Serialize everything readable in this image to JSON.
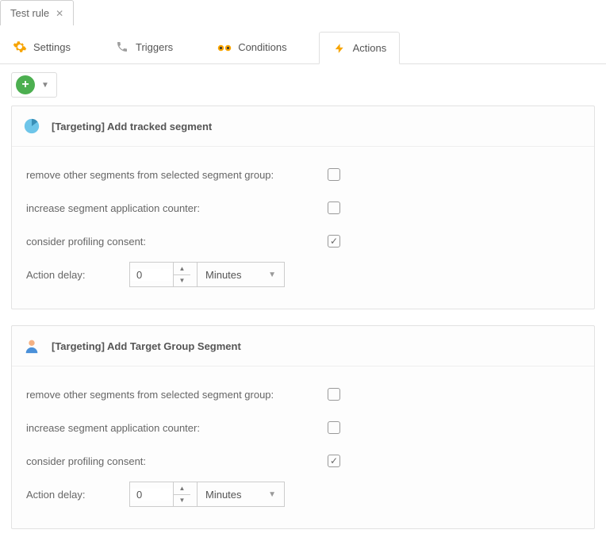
{
  "pageTab": {
    "label": "Test rule"
  },
  "navTabs": [
    {
      "label": "Settings"
    },
    {
      "label": "Triggers"
    },
    {
      "label": "Conditions"
    },
    {
      "label": "Actions"
    }
  ],
  "panels": [
    {
      "title": "[Targeting] Add tracked segment",
      "fields": {
        "removeOther": {
          "label": "remove other segments from selected segment group:",
          "checked": false
        },
        "increaseCounter": {
          "label": "increase segment application counter:",
          "checked": false
        },
        "considerConsent": {
          "label": "consider profiling consent:",
          "checked": true
        },
        "actionDelay": {
          "label": "Action delay:",
          "value": "0",
          "unit": "Minutes"
        }
      }
    },
    {
      "title": "[Targeting] Add Target Group Segment",
      "fields": {
        "removeOther": {
          "label": "remove other segments from selected segment group:",
          "checked": false
        },
        "increaseCounter": {
          "label": "increase segment application counter:",
          "checked": false
        },
        "considerConsent": {
          "label": "consider profiling consent:",
          "checked": true
        },
        "actionDelay": {
          "label": "Action delay:",
          "value": "0",
          "unit": "Minutes"
        }
      }
    }
  ]
}
